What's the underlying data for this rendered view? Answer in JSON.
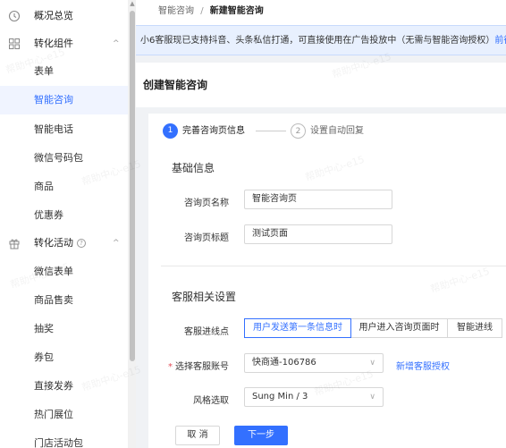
{
  "sidebar": {
    "items": [
      {
        "label": "概况总览",
        "icon": "clock-icon"
      },
      {
        "label": "转化组件",
        "icon": "grid-icon",
        "chevron": "^"
      },
      {
        "label": "表单"
      },
      {
        "label": "智能咨询",
        "active": true
      },
      {
        "label": "智能电话"
      },
      {
        "label": "微信号码包"
      },
      {
        "label": "商品"
      },
      {
        "label": "优惠券"
      },
      {
        "label": "转化活动",
        "icon": "gift-icon",
        "help": "?",
        "chevron": "^"
      },
      {
        "label": "微信表单"
      },
      {
        "label": "商品售卖"
      },
      {
        "label": "抽奖"
      },
      {
        "label": "券包"
      },
      {
        "label": "直接发券"
      },
      {
        "label": "热门展位"
      },
      {
        "label": "门店活动包"
      }
    ]
  },
  "breadcrumb": {
    "parent": "智能咨询",
    "separator": "/",
    "current": "新建智能咨询"
  },
  "notice": {
    "text": "小6客服现已支持抖音、头条私信打通，可直接使用在广告投放中（无需与智能咨询授权）",
    "link": "前往"
  },
  "page_title": "创建智能咨询",
  "steps": [
    {
      "num": "1",
      "label": "完善咨询页信息"
    },
    {
      "num": "2",
      "label": "设置自动回复"
    }
  ],
  "basic": {
    "title": "基础信息",
    "name_label": "咨询页名称",
    "name_value": "智能咨询页",
    "page_title_label": "咨询页标题",
    "page_title_value": "测试页面"
  },
  "service": {
    "title": "客服相关设置",
    "entry_label": "客服进线点",
    "entry_options": [
      "用户发送第一条信息时",
      "用户进入咨询页面时",
      "智能进线"
    ],
    "account_required": "*",
    "account_label": "选择客服账号",
    "account_value": "快商通-106786",
    "add_auth": "新增客服授权",
    "style_label": "风格选取",
    "style_value": "Sung Min / 3"
  },
  "buttons": {
    "cancel": "取 消",
    "next": "下一步"
  },
  "watermark": "帮助中心-e15",
  "colors": {
    "accent": "#3370ff",
    "notice_bg": "#e8f0fe",
    "required": "#e34d59"
  }
}
